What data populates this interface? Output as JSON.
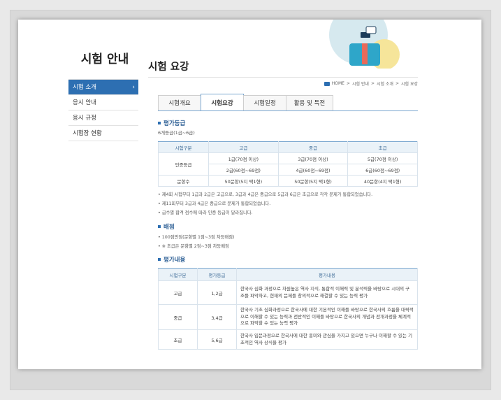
{
  "sidebar": {
    "title": "시험 안내",
    "items": [
      {
        "label": "시험 소개",
        "active": true
      },
      {
        "label": "응시 안내"
      },
      {
        "label": "응시 규정"
      },
      {
        "label": "시험장 현황"
      }
    ]
  },
  "header": {
    "title": "시험 요강",
    "breadcrumb": [
      "HOME",
      "시험 안내",
      "시험 소개",
      "시험 요강"
    ]
  },
  "tabs": [
    {
      "label": "시험개요"
    },
    {
      "label": "시험요강",
      "active": true
    },
    {
      "label": "시험일정"
    },
    {
      "label": "활용 및 특전"
    }
  ],
  "grading": {
    "heading": "평가등급",
    "subtitle": "6개등급(1급~6급)",
    "headers": [
      "시험구분",
      "고급",
      "중급",
      "초급"
    ],
    "cert_label": "인증등급",
    "rows": [
      [
        "1급(70점 이상)",
        "3급(70점 이상)",
        "5급(70점 이상)"
      ],
      [
        "2급(60점~69점)",
        "4급(60점~69점)",
        "6급(60점~69점)"
      ]
    ],
    "count_label": "문항수",
    "counts": [
      "50문항(5지 택1형)",
      "50문항(5지 택1형)",
      "40문항(4지 택1형)"
    ],
    "notes": [
      "• 제4회 시험부터 1급과 2급은 고급으로, 3급과 4급은 중급으로 5급과 6급은 초급으로 각각 문제가 통합되었습니다.",
      "• 제11회부터 3급과 4급은 중급으로 문제가 통합되었습니다.",
      "• 급수별 합격 점수에 따라 인증 등급이 달라집니다."
    ]
  },
  "scoring": {
    "heading": "배점",
    "notes": [
      "• 100점만점(문항별 1점~3점 차등배점)",
      "• ※ 초급은 문항별 2점~3점 차등배점"
    ]
  },
  "content": {
    "heading": "평가내용",
    "headers": [
      "시험구분",
      "평가등급",
      "평가내용"
    ],
    "rows": [
      {
        "level": "고급",
        "grade": "1,2급",
        "desc": "한국사 심화 과정으로 차원높은 역사 지식, 통합적 이해력 및 분석력을 바탕으로 시대의 구조를 파악하고, 현재의 문제를 창의적으로 해결할 수 있는 능력 평가"
      },
      {
        "level": "중급",
        "grade": "3,4급",
        "desc": "한국사 기초 심화과정으로 한국사에 대한 기본적인 이해를 바탕으로 한국사의 흐름을 대략적으로 이해할 수 있는 능력과 전반적인 이해를 바탕으로 한국사의 개념과 전개과정을 체계적으로 파악할 수 있는 능력 평가"
      },
      {
        "level": "초급",
        "grade": "5,6급",
        "desc": "한국사 입문과정으로 한국사에 대한 흥미와 관심을 가지고 있으면 누구나 이해할 수 있는 기초적인 역사 상식을 평가"
      }
    ]
  },
  "colors": {
    "accent": "#2d6fb2",
    "heading": "#2d5f95",
    "header_bg": "#eaf2f8"
  }
}
